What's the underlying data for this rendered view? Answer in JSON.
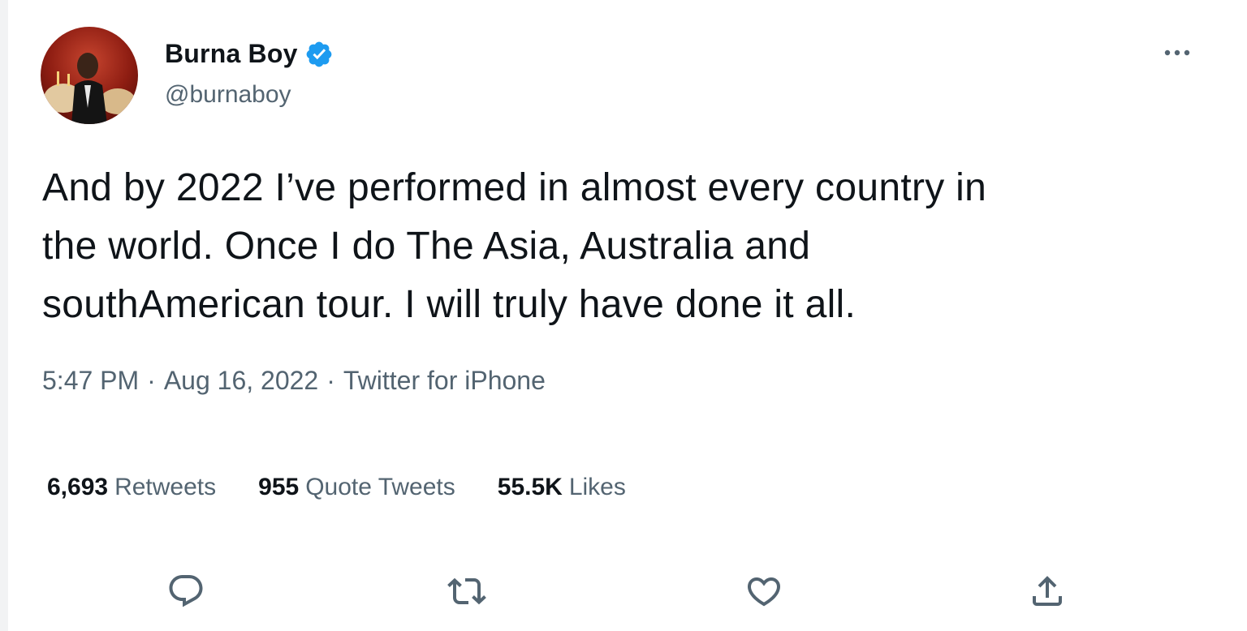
{
  "author": {
    "display_name": "Burna Boy",
    "handle": "@burnaboy",
    "verified_icon": "verified-badge-icon",
    "verified_color": "#1d9bf0"
  },
  "tweet": {
    "text": "And by 2022 I’ve performed in almost every country in\nthe world. Once I do The Asia, Australia and\nsouthAmerican tour. I will truly have done it all.",
    "time": "5:47 PM",
    "date": "Aug 16, 2022",
    "source": "Twitter for iPhone",
    "separator": "·"
  },
  "stats": {
    "retweets": {
      "count": "6,693",
      "label": "Retweets"
    },
    "quotes": {
      "count": "955",
      "label": "Quote Tweets"
    },
    "likes": {
      "count": "55.5K",
      "label": "Likes"
    }
  },
  "actions": {
    "reply_icon": "reply-icon",
    "retweet_icon": "retweet-icon",
    "like_icon": "heart-icon",
    "share_icon": "share-icon",
    "more_icon": "more-icon",
    "icon_color": "#536471"
  }
}
